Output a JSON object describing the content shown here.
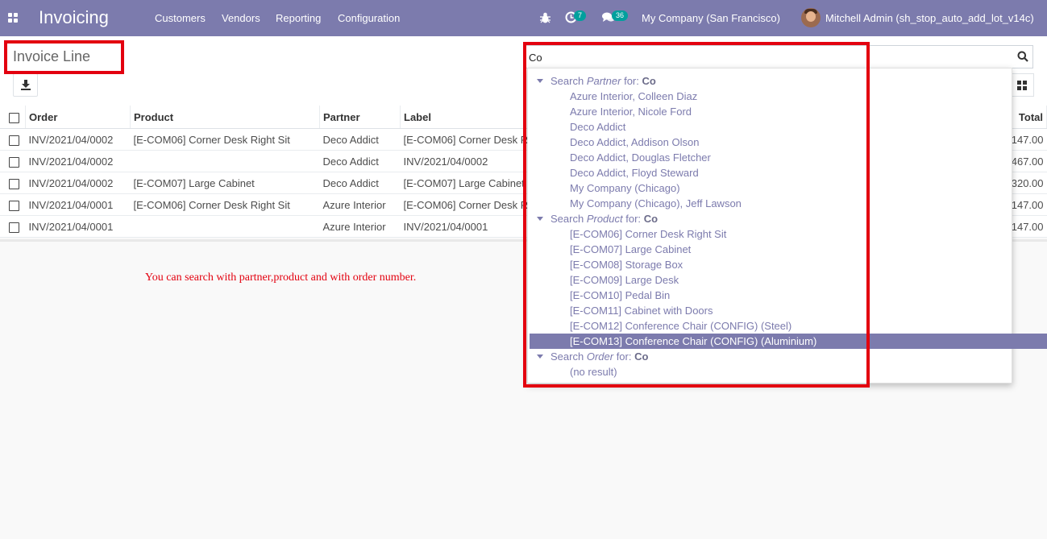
{
  "nav": {
    "app_title": "Invoicing",
    "menu": [
      "Customers",
      "Vendors",
      "Reporting",
      "Configuration"
    ],
    "activity_count": "7",
    "messages_count": "36",
    "company": "My Company (San Francisco)",
    "user": "Mitchell Admin (sh_stop_auto_add_lot_v14c)"
  },
  "control": {
    "breadcrumb": "Invoice Line",
    "search_value": "Co"
  },
  "table": {
    "columns": [
      "Order",
      "Product",
      "Partner",
      "Label",
      "Total"
    ],
    "rows": [
      {
        "order": "INV/2021/04/0002",
        "product": "[E-COM06] Corner Desk Right Sit",
        "partner": "Deco Addict",
        "label": "[E-COM06] Corner Desk R",
        "total": "147.00"
      },
      {
        "order": "INV/2021/04/0002",
        "product": "",
        "partner": "Deco Addict",
        "label": "INV/2021/04/0002",
        "total": "467.00"
      },
      {
        "order": "INV/2021/04/0002",
        "product": "[E-COM07] Large Cabinet",
        "partner": "Deco Addict",
        "label": "[E-COM07] Large Cabinet",
        "total": "320.00"
      },
      {
        "order": "INV/2021/04/0001",
        "product": "[E-COM06] Corner Desk Right Sit",
        "partner": "Azure Interior",
        "label": "[E-COM06] Corner Desk R",
        "total": "147.00"
      },
      {
        "order": "INV/2021/04/0001",
        "product": "",
        "partner": "Azure Interior",
        "label": "INV/2021/04/0001",
        "total": "147.00"
      }
    ]
  },
  "note": "You can search with partner,product and with order number.",
  "dropdown": {
    "search_prefix": "Search",
    "for_label": "for:",
    "query": "Co",
    "groups": [
      {
        "field": "Partner",
        "items": [
          "Azure Interior, Colleen Diaz",
          "Azure Interior, Nicole Ford",
          "Deco Addict",
          "Deco Addict, Addison Olson",
          "Deco Addict, Douglas Fletcher",
          "Deco Addict, Floyd Steward",
          "My Company (Chicago)",
          "My Company (Chicago), Jeff Lawson"
        ]
      },
      {
        "field": "Product",
        "items": [
          "[E-COM06] Corner Desk Right Sit",
          "[E-COM07] Large Cabinet",
          "[E-COM08] Storage Box",
          "[E-COM09] Large Desk",
          "[E-COM10] Pedal Bin",
          "[E-COM11] Cabinet with Doors",
          "[E-COM12] Conference Chair (CONFIG) (Steel)",
          "[E-COM13] Conference Chair (CONFIG) (Aluminium)"
        ]
      },
      {
        "field": "Order",
        "items": [
          "(no result)"
        ]
      }
    ],
    "active_item": "[E-COM13] Conference Chair (CONFIG) (Aluminium)"
  },
  "colors": {
    "brand": "#7c7bad",
    "highlight": "#e3000f",
    "badge": "#00a09d"
  }
}
